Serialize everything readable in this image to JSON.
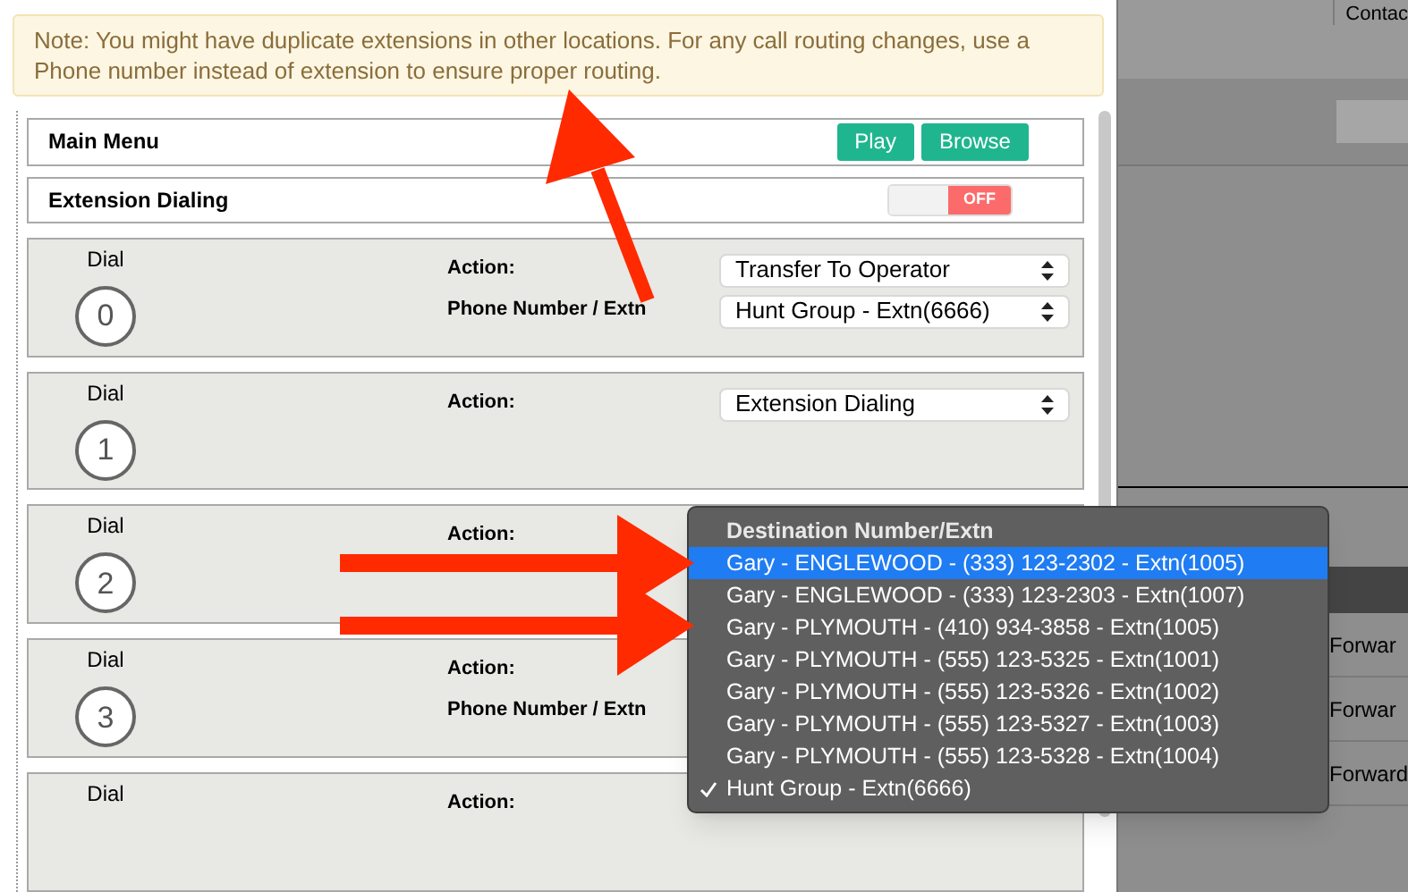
{
  "notice": "Note: You might have duplicate extensions in other locations. For any call routing changes, use a Phone number instead of extension to ensure proper routing.",
  "main_menu": {
    "title": "Main Menu",
    "buttons": [
      "Play",
      "Browse"
    ]
  },
  "extension_dialing": {
    "title": "Extension Dialing",
    "on": false,
    "toggle_label": "OFF"
  },
  "dials": [
    {
      "label": "Dial",
      "number": "0",
      "action_label": "Action:",
      "action": "Transfer To Operator",
      "phone_label": "Phone Number / Extn",
      "phone": "Hunt Group - Extn(6666)"
    },
    {
      "label": "Dial",
      "number": "1",
      "action_label": "Action:",
      "action": "Extension Dialing"
    },
    {
      "label": "Dial",
      "number": "2",
      "action_label": "Action:"
    },
    {
      "label": "Dial",
      "number": "3",
      "action_label": "Action:",
      "phone_label": "Phone Number / Extn"
    },
    {
      "label": "Dial",
      "action_label": "Action:"
    }
  ],
  "dropdown": {
    "header": "Destination Number/Extn",
    "items": [
      {
        "label": "Gary - ENGLEWOOD - (333) 123-2302 - Extn(1005)",
        "selected": true,
        "checked": false
      },
      {
        "label": "Gary - ENGLEWOOD - (333) 123-2303 - Extn(1007)",
        "selected": false,
        "checked": false
      },
      {
        "label": "Gary - PLYMOUTH - (410) 934-3858 - Extn(1005)",
        "selected": false,
        "checked": false
      },
      {
        "label": "Gary - PLYMOUTH - (555) 123-5325 - Extn(1001)",
        "selected": false,
        "checked": false
      },
      {
        "label": "Gary - PLYMOUTH - (555) 123-5326 - Extn(1002)",
        "selected": false,
        "checked": false
      },
      {
        "label": "Gary - PLYMOUTH - (555) 123-5327 - Extn(1003)",
        "selected": false,
        "checked": false
      },
      {
        "label": "Gary - PLYMOUTH - (555) 123-5328 - Extn(1004)",
        "selected": false,
        "checked": false
      },
      {
        "label": "Hunt Group - Extn(6666)",
        "selected": false,
        "checked": true
      }
    ]
  },
  "background": {
    "header_text": "Contac",
    "rows": [
      "Forwar",
      "Forwar",
      "Forward"
    ]
  }
}
